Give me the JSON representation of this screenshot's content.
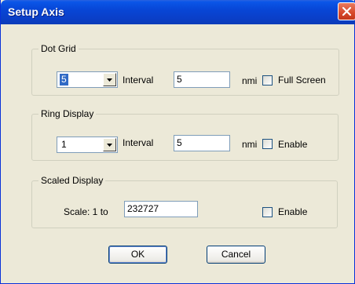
{
  "window": {
    "title": "Setup Axis"
  },
  "dot_grid": {
    "legend": "Dot Grid",
    "value": "5",
    "interval_label": "Interval",
    "interval_value": "5",
    "unit": "nmi",
    "checkbox_label": "Full Screen"
  },
  "ring_display": {
    "legend": "Ring Display",
    "value": "1",
    "interval_label": "Interval",
    "interval_value": "5",
    "unit": "nmi",
    "checkbox_label": "Enable"
  },
  "scaled_display": {
    "legend": "Scaled Display",
    "scale_label": "Scale: 1 to",
    "scale_value": "232727",
    "checkbox_label": "Enable"
  },
  "buttons": {
    "ok": "OK",
    "cancel": "Cancel"
  }
}
